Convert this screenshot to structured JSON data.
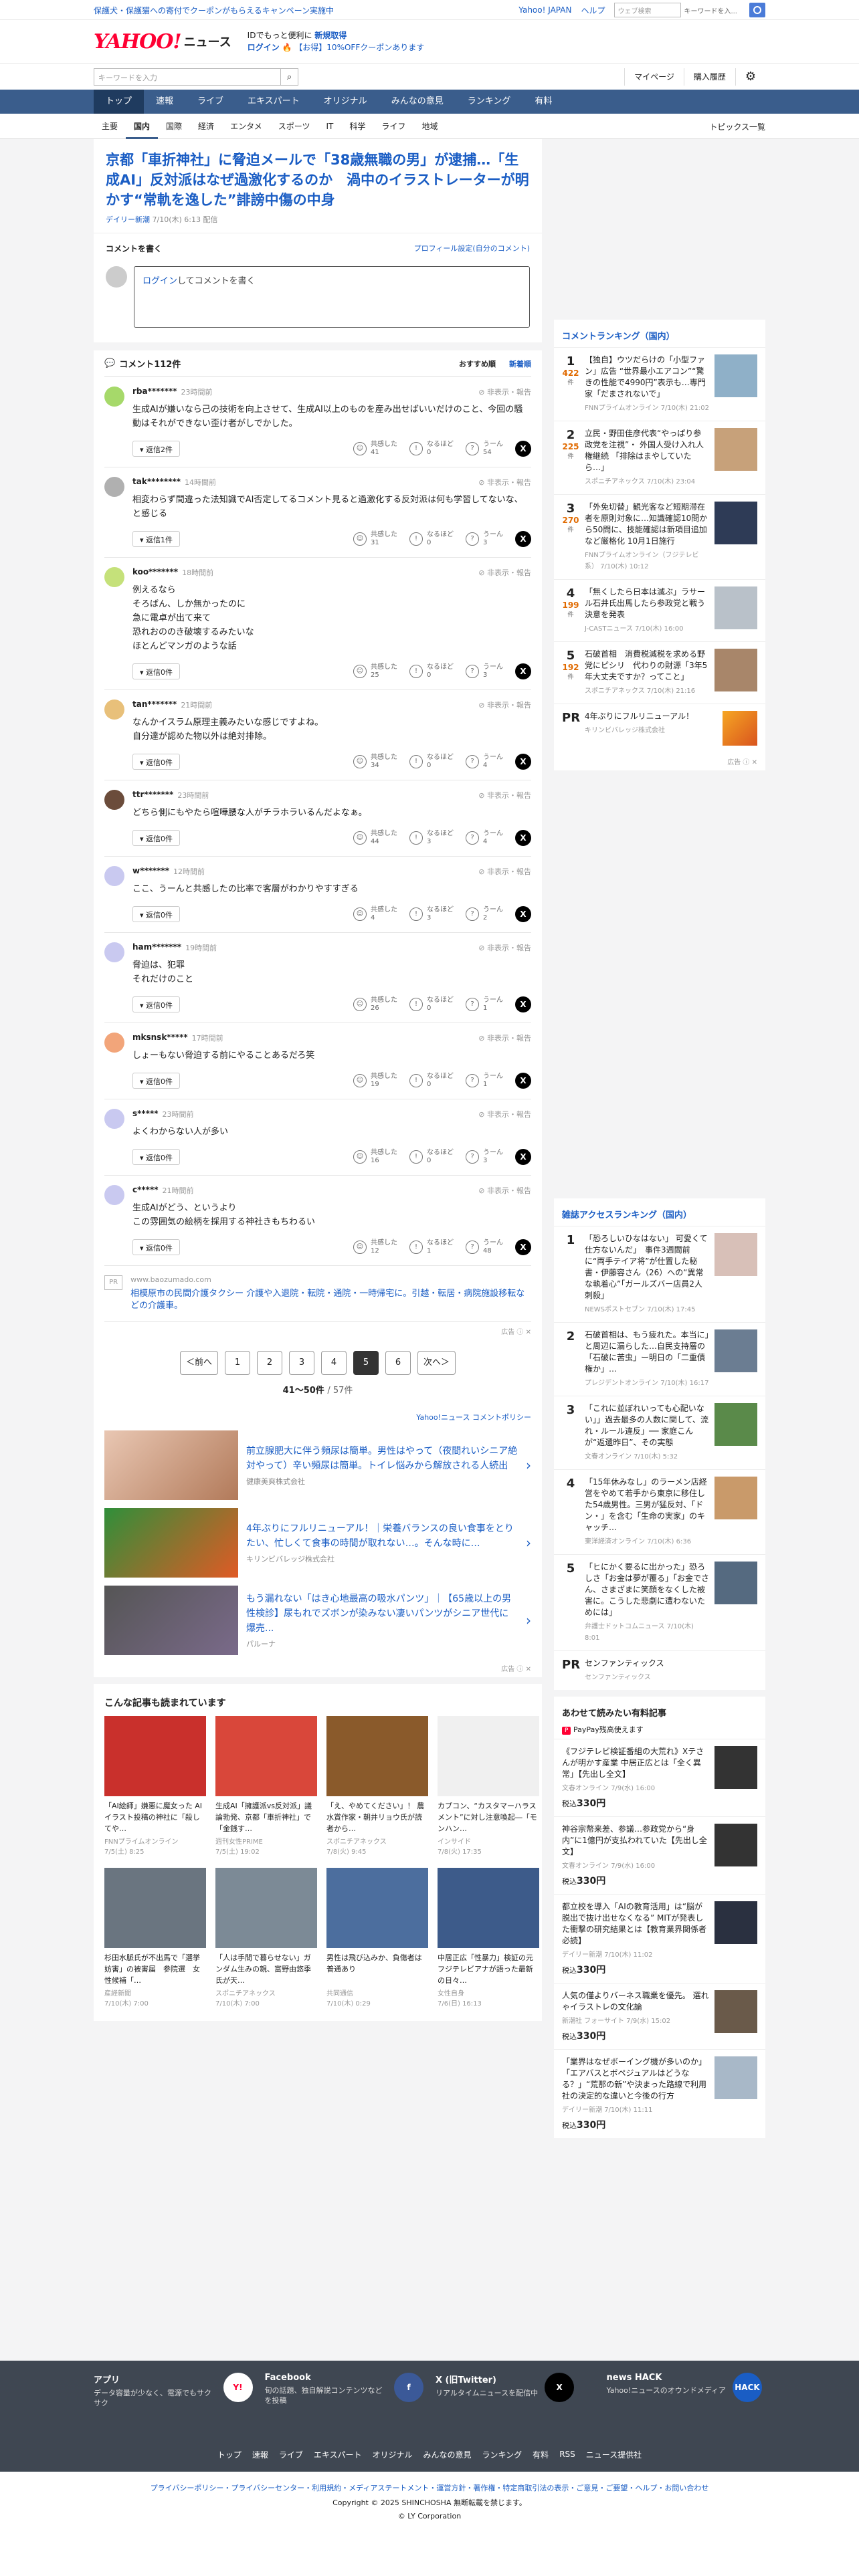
{
  "topbar": {
    "promo": "保護犬・保護猫への寄付でクーポンがもらえるキャンペーン実施中",
    "links": [
      "Yahoo! JAPAN",
      "ヘルプ"
    ],
    "search_placeholder": "ウェブ検索",
    "search_hint": "キーワードを入..."
  },
  "mast": {
    "logo": "YAHOO!",
    "logo_sub": "ニュース",
    "msg1": "IDでもっと便利に",
    "msg1_link": "新規取得",
    "msg2_link": "ログイン",
    "msg2_extra": "【お得】10%OFFクーポンあります"
  },
  "search": {
    "placeholder": "キーワードを入力",
    "mypage": "マイページ",
    "purchase": "購入履歴"
  },
  "nav": {
    "items": [
      "トップ",
      "速報",
      "ライブ",
      "エキスパート",
      "オリジナル",
      "みんなの意見",
      "ランキング",
      "有料"
    ]
  },
  "subnav": {
    "items": [
      "主要",
      "国内",
      "国際",
      "経済",
      "エンタメ",
      "スポーツ",
      "IT",
      "科学",
      "ライフ",
      "地域"
    ],
    "topics": "トピックス一覧"
  },
  "article": {
    "title": "京都「車折神社」に脅迫メールで「38歳無職の男」が逮捕…「生成AI」反対派はなぜ過激化するのか　渦中のイラストレーターが明かす“常軌を逸した”誹謗中傷の中身",
    "source": "デイリー新潮",
    "date": "7/10(木) 6:13",
    "edited": "配信"
  },
  "comment_write": {
    "title": "コメントを書く",
    "profile": "プロフィール設定(自分のコメント)",
    "login": "ログイン",
    "rest": "してコメントを書く"
  },
  "comments_head": {
    "count": "コメント112件",
    "sort_new": "おすすめ順",
    "sort_recent": "新着順"
  },
  "comments": [
    {
      "user": "rba*******",
      "time": "23時間前",
      "text": "生成AIが嫌いなら己の技術を向上させて、生成AI以上のものを産み出せばいいだけのこと、今回の騒動はそれができない歪け者がしでかした。",
      "replies": "返信2件",
      "a": "41",
      "b": "0",
      "c": "54"
    },
    {
      "user": "tak********",
      "time": "14時間前",
      "text": "相変わらず間違った法知識でAI否定してるコメント見ると過激化する反対派は何も学習してないな、と感じる",
      "replies": "返信1件",
      "a": "31",
      "b": "0",
      "c": "3"
    },
    {
      "user": "koo*******",
      "time": "18時間前",
      "text": "例えるなら\nそろばん、しか無かったのに\n急に電卓が出て来て\n恐れおののき破壊するみたいな\nほとんどマンガのような話",
      "replies": "返信0件",
      "a": "25",
      "b": "0",
      "c": "3"
    },
    {
      "user": "tan*******",
      "time": "21時間前",
      "text": "なんかイスラム原理主義みたいな感じですよね。\n自分達が認めた物以外は絶対排除。",
      "replies": "返信0件",
      "a": "34",
      "b": "0",
      "c": "4"
    },
    {
      "user": "ttr*******",
      "time": "23時間前",
      "text": "どちら側にもやたら喧嘩腰な人がチラホラいるんだよなぁ。",
      "replies": "返信0件",
      "a": "44",
      "b": "3",
      "c": "4"
    },
    {
      "user": "w*******",
      "time": "12時間前",
      "text": "ここ、うーんと共感したの比率で客層がわかりやすすぎる",
      "replies": "返信0件",
      "a": "4",
      "b": "3",
      "c": "2"
    },
    {
      "user": "ham*******",
      "time": "19時間前",
      "text": "脅迫は、犯罪\nそれだけのこと",
      "replies": "返信0件",
      "a": "26",
      "b": "0",
      "c": "1"
    },
    {
      "user": "mksnsk*****",
      "time": "17時間前",
      "text": "しょーもない脅迫する前にやることあるだろ笑",
      "replies": "返信0件",
      "a": "19",
      "b": "0",
      "c": "1"
    },
    {
      "user": "s*****",
      "time": "23時間前",
      "text": "よくわからない人が多い",
      "replies": "返信0件",
      "a": "16",
      "b": "0",
      "c": "3"
    },
    {
      "user": "c*****",
      "time": "21時間前",
      "text": "生成AIがどう、というより\nこの雰囲気の絵柄を採用する神社きもちわるい",
      "replies": "返信0件",
      "a": "12",
      "b": "1",
      "c": "48"
    }
  ],
  "labels": {
    "report": "非表示・報告",
    "sympathy": "共感した",
    "insight": "なるほど",
    "hmm": "うーん",
    "ad": "広告",
    "pr": "PR"
  },
  "ad_inline": {
    "url": "www.baozumado.com",
    "text": "相模原市の民間介護タクシー 介護や入退院・転院・通院・一時帰宅に。引越・転居・病院施設移転などの介護車。"
  },
  "pager": {
    "prev": "＜前へ",
    "pages": [
      "1",
      "2",
      "3",
      "4",
      "5",
      "6"
    ],
    "next": "次へ＞",
    "info": "41〜50件",
    "total": "/ 57件"
  },
  "policy": "Yahoo!ニュース コメントポリシー",
  "ads_left": [
    {
      "text": "前立腺肥大に伴う頻尿は簡単。男性はやって（夜間れいシニア絶対やって）辛い頻尿は簡単。トイレ悩みから解放される人続出",
      "src": "健康美爽株式会社"
    },
    {
      "text": "4年ぶりにフルリニューアル！｜栄養バランスの良い食事をとりたい、忙しくて食事の時間が取れない…。そんな時に…",
      "src": "キリンビバレッジ株式会社"
    },
    {
      "text": "もう漏れない「はき心地最高の吸水パンツ」｜【65歳以上の男性検診】尿もれでズボンが染みない凄いパンツがシニア世代に爆売...",
      "src": "パルーナ"
    }
  ],
  "read_also": {
    "title": "こんな記事も読まれています",
    "items": [
      {
        "t": "「AI絵師」嫌悪に魔女った AIイラスト投稿の神社に「殺してや…",
        "s": "FNNプライムオンライン",
        "d": "7/5(土) 8:25"
      },
      {
        "t": "生成AI「擁護派vs反対派」議論勃発、京都「車折神社」で「金銭す…",
        "s": "週刊女性PRIME",
        "d": "7/5(土) 19:02"
      },
      {
        "t": "「え、やめてください」！ 農水賞作家・朝井リョウ氏が読者から…",
        "s": "スポニチアネックス",
        "d": "7/8(火) 9:45"
      },
      {
        "t": "カプコン、“カスタマーハラスメント”に対し注意喚起―「モンハン…",
        "s": "インサイド",
        "d": "7/8(火) 17:35"
      },
      {
        "t": "杉田水脈氏が不出馬で「選挙妨害」の被害届　参院選　女性候補「…",
        "s": "産経新聞",
        "d": "7/10(木) 7:00"
      },
      {
        "t": "「人は手間で暮らせない」ガンダム生みの親、富野由悠季氏が天…",
        "s": "スポニチアネックス",
        "d": "7/10(木) 7:00"
      },
      {
        "t": "男性は飛び込みか、負傷者は普通あり",
        "s": "共同通信",
        "d": "7/10(木) 0:29"
      },
      {
        "t": "中居正広「性暴力」検証の元フジテレビアナが語った最新の日々…",
        "s": "女性自身",
        "d": "7/6(日) 16:13"
      }
    ]
  },
  "ranking1": {
    "title": "コメントランキング（国内）",
    "items": [
      {
        "n": "1",
        "c": "422",
        "t": "【独自】ウツだらけの「小型ファン」広告 “世界最小エアコン”“驚きの性能で4990円”表示も…専門家「だまされないで」",
        "s": "FNNプライムオンライン",
        "d": "7/10(木) 21:02"
      },
      {
        "n": "2",
        "c": "225",
        "t": "立民・野田佳彦代表“やっぱり参政党を注視”・ 外国人受け入れ人権継続 「排除はまやしていたら…」",
        "s": "スポニチアネックス",
        "d": "7/10(木) 23:04"
      },
      {
        "n": "3",
        "c": "270",
        "t": "「外免切替」観光客など短期滞在者を原則対象に…知識確認10問から50問に、技能確認は新項目追加など厳格化 10月1日施行",
        "s": "FNNプライムオンライン（フジテレビ系）",
        "d": "7/10(木) 10:12"
      },
      {
        "n": "4",
        "c": "199",
        "t": "「無くしたら日本は滅ぶ」ラサール石井氏出馬したら参政党と戦う決意を発表",
        "s": "J-CASTニュース",
        "d": "7/10(木) 16:00"
      },
      {
        "n": "5",
        "c": "192",
        "t": "石破首相　消費税減税を求める野党にピシリ　代わりの財源「3年5年大丈夫ですか？ってこと」",
        "s": "スポニチアネックス",
        "d": "7/10(木) 21:16"
      }
    ],
    "pr_text": "4年ぶりにフルリニューアル！",
    "pr_src": "キリンビバレッジ株式会社",
    "unit": "件"
  },
  "ranking2": {
    "title": "雑誌アクセスランキング（国内）",
    "items": [
      {
        "n": "1",
        "t": "「恐ろしいひなはない」 可愛くて仕方ないんだ」　事件3週間前に“両手テイア将”が仕置した秘書・伊藤容さん（26）への“異常な執着心”「ガールズバー店員2人刺殺」",
        "s": "NEWSポストセブン",
        "d": "7/10(木) 17:45"
      },
      {
        "n": "2",
        "t": "石破首相は、もう疲れた。本当に」と周辺に漏らした…自民支持層の「石破に苦虫」ー明日の「二重債権か」…",
        "s": "プレジデントオンライン",
        "d": "7/10(木) 16:17"
      },
      {
        "n": "3",
        "t": "「これに並ぼれいっても心配いない」」過去最多の人数に関して、流れ・ルール違反」── 家庭こんが“返還昨日”、その実態",
        "s": "文春オンライン",
        "d": "7/10(木) 5:32"
      },
      {
        "n": "4",
        "t": "「15年休みなし」のラーメン店経営をやめて若手から東京に移住した54歳男性。三男が猛反対、「ドン・」を含む「生命の実家」のキャッチ…",
        "s": "東洋経済オンライン",
        "d": "7/10(木) 6:36"
      },
      {
        "n": "5",
        "t": "「ヒにかく要るに出かった」恐ろしさ「お金は夢が覆る」「お金でさん、さまざまに笑顔をなくした被害に。こうした悲劇に遭わないためには」",
        "s": "弁護士ドットコムニュース",
        "d": "7/10(木) 8:01"
      }
    ],
    "pr_text": "センファンティックス",
    "pr_src": "センファンティックス"
  },
  "paid": {
    "title": "あわせて読みたい有料記事",
    "badge": "PayPay残高使えます",
    "items": [
      {
        "t": "《フジテレビ検証番組の大荒れ》Xテさんが明かす産業 中居正広とは「全く異常」【先出し全文】",
        "s": "文春オンライン",
        "d": "7/9(水) 16:00",
        "p": "330円"
      },
      {
        "t": "神谷宗幣来差、参議…参政党から“身内”に1億円が支払われていた【先出し全文】",
        "s": "文春オンライン",
        "d": "7/9(水) 16:00",
        "p": "330円"
      },
      {
        "t": "都立校を導入「AIの教育活用」は“脳が脱出で抜け出せなくなる” MITが発表した衝撃の研究結果とは【教育業界関係者必読】",
        "s": "デイリー新潮",
        "d": "7/10(木) 11:02",
        "p": "330円"
      },
      {
        "t": "人気の僅よりバーネス職業を優先。 選れゃイラストレの文化論",
        "s": "新潮社 フォーサイト",
        "d": "7/9(水) 15:02",
        "p": "330円"
      },
      {
        "t": "「業界はなぜボーイング機が多いのか」「エアバスとボペジュアルはどうなる？」“荒那の新”や決まった路線で利用社の決定的な違いと今後の行方",
        "s": "デイリー新潮",
        "d": "7/10(木) 11:11",
        "p": "330円"
      }
    ],
    "tax": "税込"
  },
  "footer": {
    "cols": [
      {
        "t": "アプリ",
        "d": "データ容量が少なく、電源でもサクサク",
        "i": "Y!"
      },
      {
        "t": "Facebook",
        "d": "旬の話題、独自解説コンテンツなどを投稿",
        "i": "f"
      },
      {
        "t": "X (旧Twitter)",
        "d": "リアルタイムニュースを配信中",
        "i": "X"
      },
      {
        "t": "news HACK",
        "d": "Yahoo!ニュースのオウンドメディア",
        "i": "HACK"
      }
    ],
    "links": [
      "トップ",
      "速報",
      "ライブ",
      "エキスパート",
      "オリジナル",
      "みんなの意見",
      "ランキング",
      "有料",
      "RSS",
      "ニュース提供社"
    ],
    "legal": "プライバシーポリシー・プライバシーセンター・利用規約・メディアステートメント・運営方針・著作権・特定商取引法の表示・ご意見・ご要望・ヘルプ・お問い合わせ",
    "copy1": "Copyright © 2025 SHINCHOSHA 無断転載を禁じます。",
    "copy2": "© LY Corporation"
  }
}
